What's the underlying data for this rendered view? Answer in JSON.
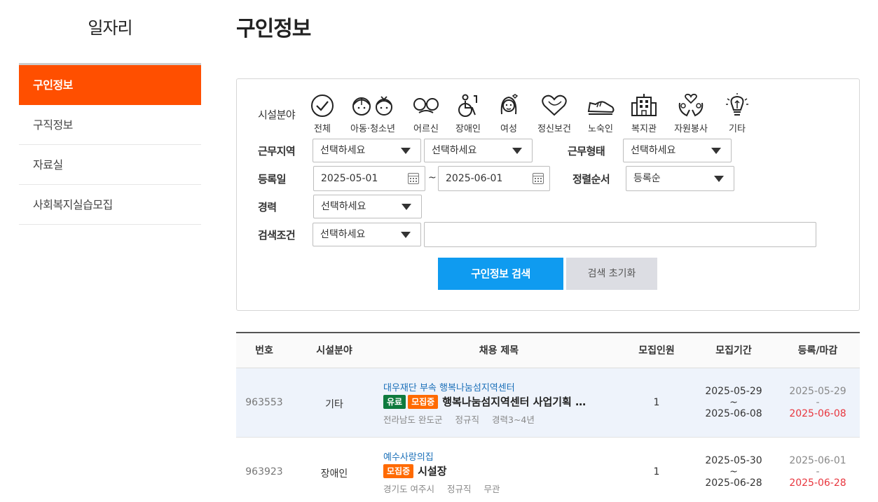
{
  "sidebar": {
    "title": "일자리",
    "items": [
      {
        "label": "구인정보",
        "active": true
      },
      {
        "label": "구직정보"
      },
      {
        "label": "자료실"
      },
      {
        "label": "사회복지실습모집"
      }
    ]
  },
  "page_title": "구인정보",
  "search": {
    "facility_label": "시설분야",
    "categories": [
      {
        "label": "전체",
        "icon": "check-circle-icon"
      },
      {
        "label": "아동·청소년",
        "icon": "children-icon"
      },
      {
        "label": "어르신",
        "icon": "elderly-glasses-icon"
      },
      {
        "label": "장애인",
        "icon": "wheelchair-icon"
      },
      {
        "label": "여성",
        "icon": "woman-icon"
      },
      {
        "label": "정신보건",
        "icon": "heart-icon"
      },
      {
        "label": "노숙인",
        "icon": "shoe-icon"
      },
      {
        "label": "복지관",
        "icon": "building-icon"
      },
      {
        "label": "자원봉사",
        "icon": "helping-hands-icon"
      },
      {
        "label": "기타",
        "icon": "lightbulb-icon"
      }
    ],
    "region_label": "근무지역",
    "region1": "선택하세요",
    "region2": "선택하세요",
    "worktype_label": "근무형태",
    "worktype": "선택하세요",
    "date_label": "등록일",
    "date_from": "2025-05-01",
    "date_tilde": "~",
    "date_to": "2025-06-01",
    "sort_label": "정렬순서",
    "sort": "등록순",
    "career_label": "경력",
    "career": "선택하세요",
    "condition_label": "검색조건",
    "condition": "선택하세요",
    "keyword": "",
    "search_button": "구인정보 검색",
    "reset_button": "검색 초기화"
  },
  "table": {
    "headers": [
      "번호",
      "시설분야",
      "채용 제목",
      "모집인원",
      "모집기간",
      "등록/마감"
    ],
    "rows": [
      {
        "no": "963553",
        "field": "기타",
        "org": "대우재단 부속 행복나눔섬지역센터",
        "badges": [
          "유료",
          "모집중"
        ],
        "title": "행복나눔섬지역센터 사업기획 …",
        "location": "전라남도 완도군",
        "employment": "정규직",
        "career": "경력3~4년",
        "count": "1",
        "period_start": "2025-05-29",
        "period_sep": "~",
        "period_end": "2025-06-08",
        "registered": "2025-05-29",
        "reg_sep": "-",
        "deadline": "2025-06-08",
        "highlight": true
      },
      {
        "no": "963923",
        "field": "장애인",
        "org": "예수사랑의집",
        "badges": [
          "모집중"
        ],
        "title": "시설장",
        "location": "경기도 여주시",
        "employment": "정규직",
        "career": "무관",
        "count": "1",
        "period_start": "2025-05-30",
        "period_sep": "~",
        "period_end": "2025-06-28",
        "registered": "2025-06-01",
        "reg_sep": "-",
        "deadline": "2025-06-28",
        "highlight": false
      }
    ]
  },
  "colors": {
    "accent": "#ff4f00",
    "search_button": "#0f9bf0",
    "badge_paid": "#0e7a3e",
    "badge_recruiting": "#ff6a00",
    "deadline": "#e8363e"
  }
}
